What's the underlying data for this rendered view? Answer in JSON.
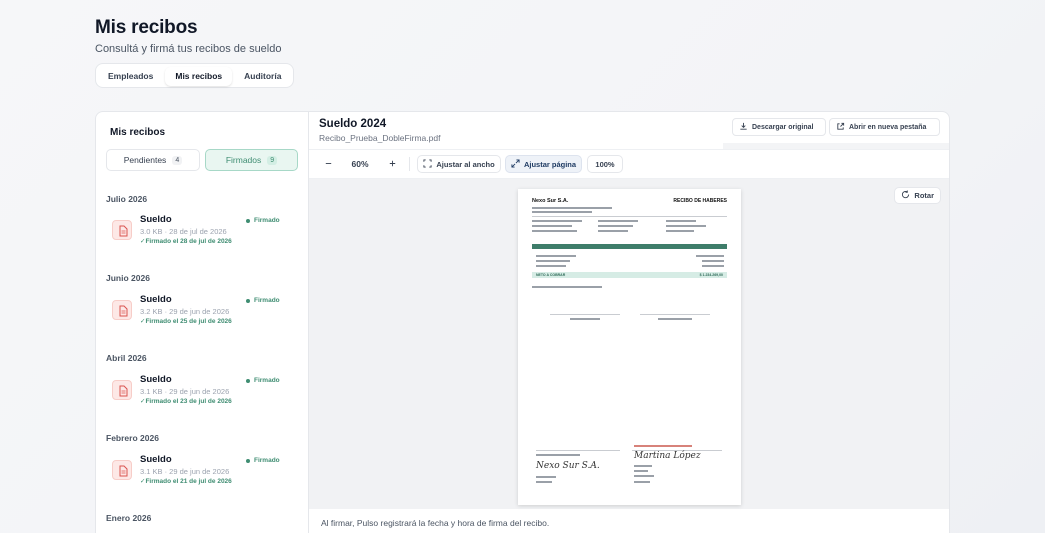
{
  "header": {
    "title": "Mis recibos",
    "subtitle": "Consultá y firmá tus recibos de sueldo"
  },
  "top_tabs": [
    {
      "label": "Empleados",
      "active": false
    },
    {
      "label": "Mis recibos",
      "active": true
    },
    {
      "label": "Auditoría",
      "active": false
    }
  ],
  "left": {
    "title": "Mis recibos",
    "filters": {
      "pending_label": "Pendientes",
      "pending_count": "4",
      "signed_label": "Firmados",
      "signed_count": "9"
    },
    "months": [
      "Julio 2026",
      "Junio 2026",
      "Abril 2026",
      "Febrero 2026",
      "Enero 2026"
    ],
    "items": [
      {
        "name": "Sueldo",
        "meta": "3.0 KB · 28 de jul de 2026",
        "signed": "✓Firmado el 28 de jul de 2026",
        "badge": "Firmado"
      },
      {
        "name": "Sueldo",
        "meta": "3.2 KB · 29 de jun de 2026",
        "signed": "✓Firmado el 25 de jul de 2026",
        "badge": "Firmado"
      },
      {
        "name": "Sueldo",
        "meta": "3.1 KB · 29 de jun de 2026",
        "signed": "✓Firmado el 23 de jul de 2026",
        "badge": "Firmado"
      },
      {
        "name": "Sueldo",
        "meta": "3.1 KB · 29 de jun de 2026",
        "signed": "✓Firmado el 21 de jul de 2026",
        "badge": "Firmado"
      }
    ]
  },
  "document": {
    "title": "Sueldo 2024",
    "filename": "Recibo_Prueba_DobleFirma.pdf",
    "download_label": "Descargar original",
    "open_label": "Abrir en nueva pestaña"
  },
  "toolbar": {
    "zoom": "60%",
    "fit_width_label": "Ajustar al ancho",
    "fit_page_label": "Ajustar página",
    "actual_label": "100%"
  },
  "viewer": {
    "rotate_label": "Rotar"
  },
  "sheet": {
    "company": "Nexo Sur S.A.",
    "receipt_title": "RECIBO DE HABERES",
    "neto_label": "NETO A COBRAR",
    "neto_value": "$ 1.234.269,00",
    "employer_signature": "Nexo Sur S.A.",
    "employee_signature": "Martina López"
  },
  "footer_note": "Al firmar, Pulso registrará la fecha y hora de firma del recibo.",
  "colors": {
    "accent_green": "#3f8d72",
    "doc_icon_red": "#d9534f"
  }
}
